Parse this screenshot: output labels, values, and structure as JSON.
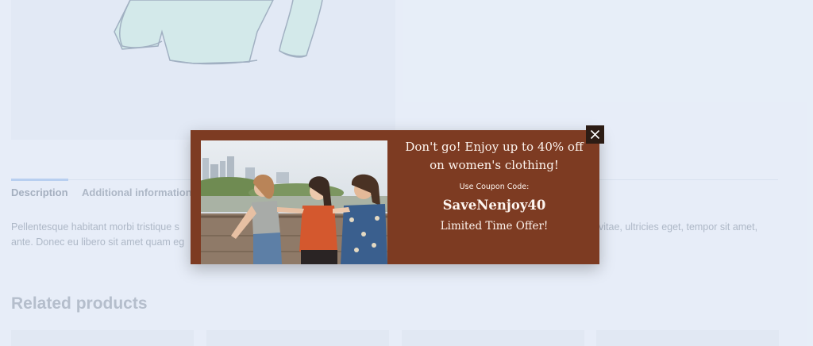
{
  "product": {
    "image_alt": "sweater"
  },
  "tabs": [
    {
      "label": "Description"
    },
    {
      "label": "Additional information"
    }
  ],
  "description": {
    "line1_start": "Pellentesque habitant morbi tristique s",
    "line1_end": "vitae, ultricies eget, tempor sit amet,",
    "line2_start": "ante. Donec eu libero sit amet quam eg"
  },
  "related": {
    "title": "Related products"
  },
  "popup": {
    "headline": "Don't go! Enjoy up to 40% off on women's clothing!",
    "coupon_label": "Use Coupon Code:",
    "coupon_code": "SaveNenjoy40",
    "offer": "Limited Time Offer!",
    "close_icon": "close-icon",
    "background_color": "#7d3b22"
  }
}
